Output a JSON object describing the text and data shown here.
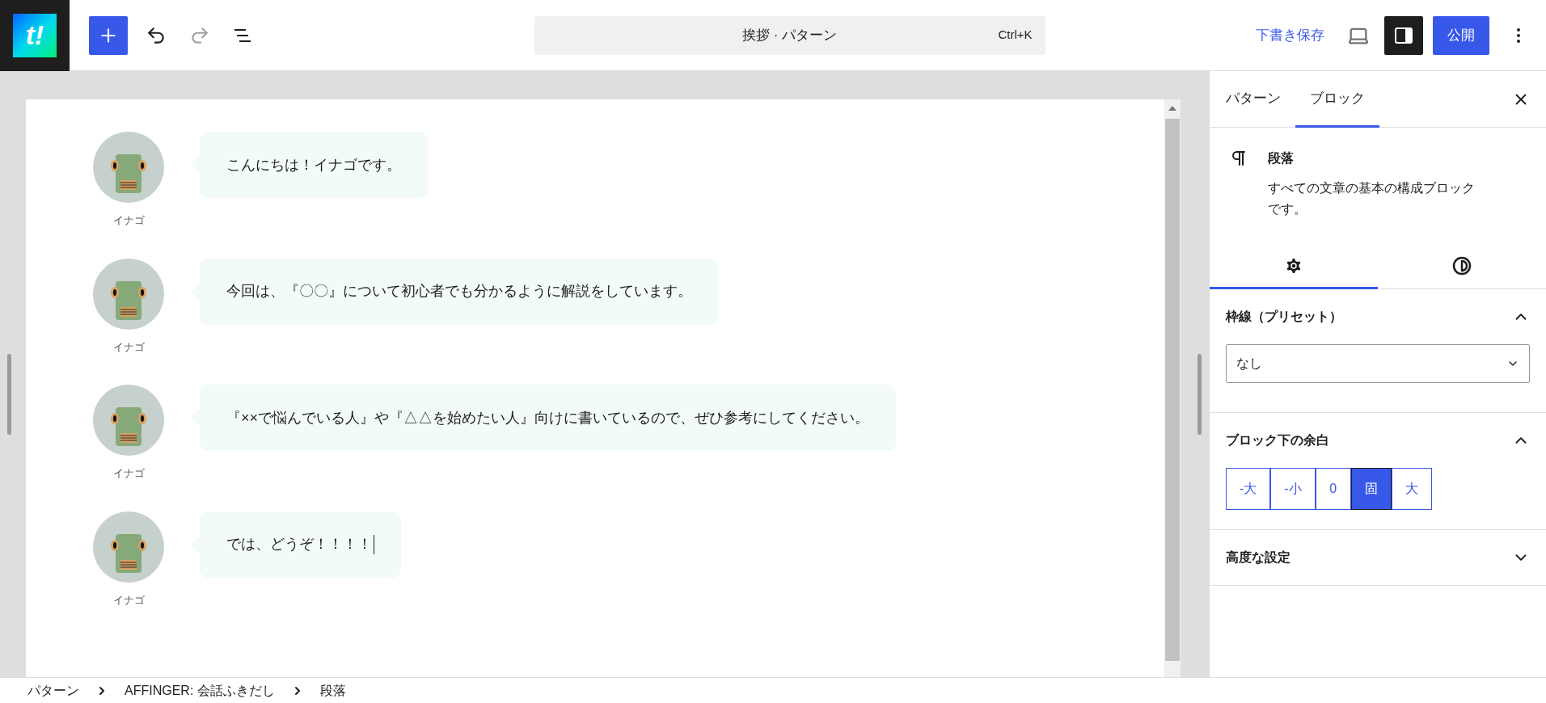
{
  "toolbar": {
    "logo_text": "t!",
    "tools": [
      {
        "kind": "undo",
        "disabled": false
      },
      {
        "kind": "redo",
        "disabled": true
      }
    ],
    "command_bar": {
      "title": "挨拶 · パターン",
      "shortcut": "Ctrl+K"
    },
    "save_draft": "下書き保存",
    "sidebar_toggle": {
      "pressed": true
    },
    "publish": "公開"
  },
  "messages": [
    {
      "name": "イナゴ",
      "text": "こんにちは！イナゴです。",
      "cursor": false
    },
    {
      "name": "イナゴ",
      "text": "今回は、『〇〇』について初心者でも分かるように解説をしています。",
      "cursor": false
    },
    {
      "name": "イナゴ",
      "text": "『××で悩んでいる人』や『△△を始めたい人』向けに書いているので、ぜひ参考にしてください。",
      "cursor": false
    },
    {
      "name": "イナゴ",
      "text": "では、どうぞ！！！！",
      "cursor": true
    }
  ],
  "sidebar": {
    "tabs": [
      {
        "label": "パターン",
        "selected": false
      },
      {
        "label": "ブロック",
        "selected": true
      }
    ],
    "block": {
      "title": "段落",
      "description": "すべての文章の基本の構成ブロックです。"
    },
    "inspector_tabs": [
      {
        "kind": "settings",
        "selected": true
      },
      {
        "kind": "styles",
        "selected": false
      }
    ],
    "panels": [
      {
        "kind": "select",
        "title": "枠線（プリセット）",
        "expanded": true,
        "value": "なし"
      },
      {
        "kind": "segmented",
        "title": "ブロック下の余白",
        "expanded": true,
        "options": [
          {
            "label": "-大",
            "selected": false
          },
          {
            "label": "-小",
            "selected": false
          },
          {
            "label": "0",
            "selected": false
          },
          {
            "label": "固",
            "selected": true
          },
          {
            "label": "大",
            "selected": false
          }
        ]
      },
      {
        "title": "高度な設定",
        "expanded": false
      }
    ]
  },
  "breadcrumbs": [
    "パターン",
    "AFFINGER: 会話ふきだし",
    "段落"
  ]
}
